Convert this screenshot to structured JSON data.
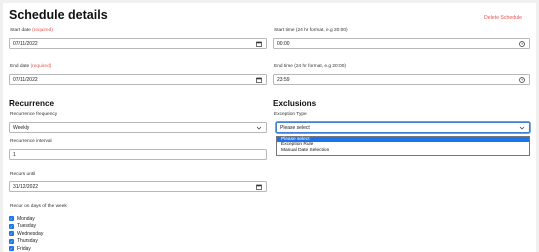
{
  "header": {
    "title": "Schedule details",
    "delete_label": "Delete Schedule"
  },
  "start_date": {
    "label": "Start date",
    "required": "(required)",
    "value": "07/11/2022"
  },
  "end_date": {
    "label": "End date",
    "required": "(required)",
    "value": "07/11/2022"
  },
  "start_time": {
    "label": "Start time (24 hr format, e.g 20:00)",
    "value": "00:00"
  },
  "end_time": {
    "label": "End time (24 hr format, e.g 20:00)",
    "value": "23:59"
  },
  "recurrence": {
    "heading": "Recurrence",
    "frequency_label": "Recurrence frequency",
    "frequency_value": "Weekly",
    "interval_label": "Recurrence interval",
    "interval_value": "1",
    "until_label": "Recurs until",
    "until_value": "31/12/2022",
    "days_label": "Recur on days of the week",
    "days": [
      "Monday",
      "Tuesday",
      "Wednesday",
      "Thursday",
      "Friday"
    ]
  },
  "exclusions": {
    "heading": "Exclusions",
    "type_label": "Exception Type",
    "type_value": "Please select",
    "options": [
      "Please select",
      "Exception Rule",
      "Manual Date Selection"
    ]
  },
  "icons": {
    "calendar": "calendar-icon",
    "clock": "clock-icon",
    "chevron": "chevron-down-icon",
    "check": "checkbox-checked-icon"
  },
  "colors": {
    "accent": "#1e73e8",
    "required": "#e8554e"
  }
}
